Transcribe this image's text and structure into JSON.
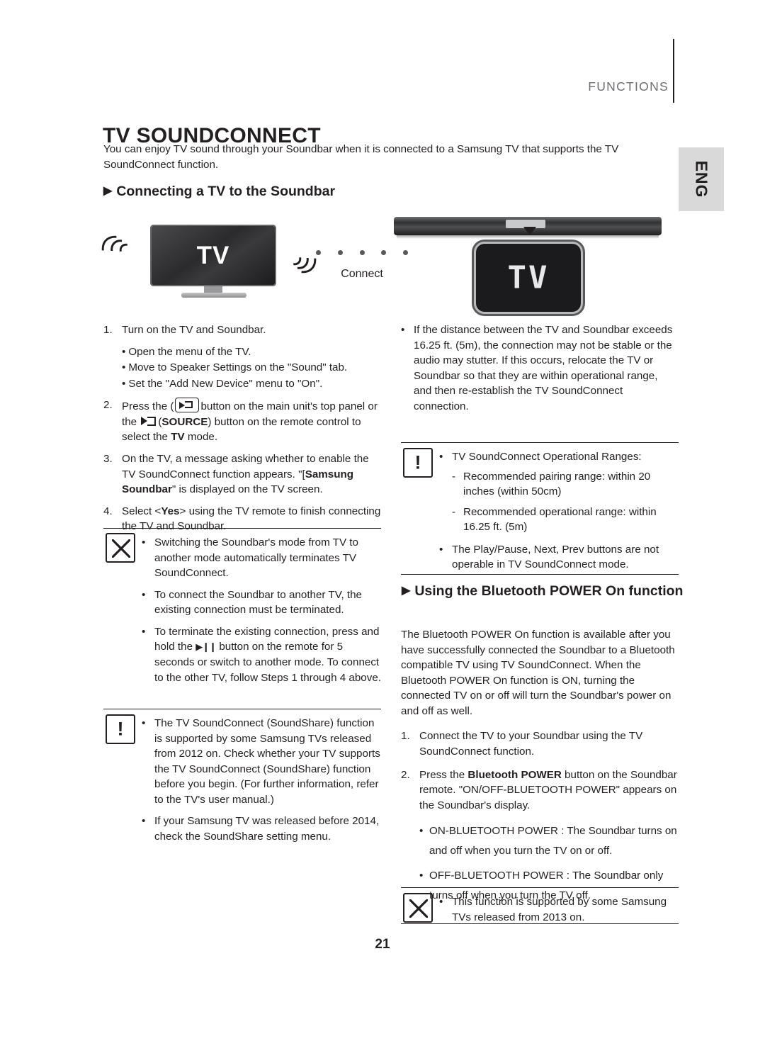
{
  "header": {
    "section_label": "FUNCTIONS",
    "lang_tab": "ENG"
  },
  "page": {
    "title": "TV SOUNDCONNECT",
    "intro": "You can enjoy TV sound through your Soundbar when it is connected to a Samsung TV that supports the TV SoundConnect function.",
    "number": "21"
  },
  "sections": {
    "connecting": {
      "heading": "Connecting a TV to the Soundbar",
      "illustration": {
        "tv_label": "TV",
        "connect_label": "Connect",
        "soundbar_display": "TV"
      },
      "steps": [
        {
          "num": "1.",
          "text": "Turn on the TV and Soundbar.",
          "subs": [
            "Open the menu of the TV.",
            "Move to Speaker Settings on the \"Sound\" tab.",
            "Set the \"Add New Device\" menu to \"On\"."
          ]
        },
        {
          "num": "2.",
          "text_pre": "Press the (",
          "text_mid": "button on the main unit's top panel or the",
          "text_src_pre": "(",
          "text_src_bold": "SOURCE",
          "text_post": ") button on the remote control to select the ",
          "text_tv_bold": "TV",
          "text_end": " mode."
        },
        {
          "num": "3.",
          "text_a": "On the TV, a message asking whether to enable the TV SoundConnect function appears. \"[",
          "text_b": "Samsung Soundbar",
          "text_c": "\" is displayed on the TV screen."
        },
        {
          "num": "4.",
          "text_a": "Select <",
          "text_b": "Yes",
          "text_c": "> using the TV remote to finish connecting the TV and Soundbar."
        }
      ],
      "memo_notes": [
        "Switching the Soundbar's mode from TV to another mode automatically terminates TV SoundConnect.",
        "To connect the Soundbar to another TV, the existing connection must be terminated."
      ],
      "memo_note_terminate_a": "To terminate the existing connection, press and hold the",
      "memo_note_terminate_b": "button on the remote for 5 seconds or switch to another mode. To connect to the other TV, follow Steps 1 through 4 above.",
      "caution_notes": [
        "The TV SoundConnect (SoundShare) function is supported by some Samsung TVs released from 2012 on. Check whether your TV supports the TV SoundConnect (SoundShare) function before you begin. (For further information, refer to the TV's user manual.)",
        "If your Samsung TV was released before 2014, check the SoundShare setting menu."
      ]
    },
    "right_column": {
      "distance_note": "If the distance between the TV and Soundbar exceeds 16.25 ft. (5m), the connection may not be stable or the audio may stutter. If this occurs, relocate the TV or Soundbar so that they are within operational range, and then re-establish the TV SoundConnect connection.",
      "caution_title": "TV SoundConnect Operational Ranges:",
      "caution_ranges": [
        "Recommended pairing range: within 20 inches (within 50cm)",
        "Recommended operational range: within 16.25 ft. (5m)"
      ],
      "caution_playpause": "The Play/Pause, Next, Prev buttons are not operable in TV SoundConnect mode."
    },
    "bluetooth": {
      "heading": "Using the Bluetooth POWER On function",
      "intro": "The Bluetooth POWER On function is available after you have successfully connected the Soundbar to a Bluetooth compatible TV using TV SoundConnect. When the Bluetooth POWER On function is ON, turning the connected TV on or off will turn the Soundbar's power on and off as well.",
      "steps": [
        {
          "num": "1.",
          "text": "Connect the TV to your Soundbar using the TV SoundConnect function."
        },
        {
          "num": "2.",
          "text_a": "Press the ",
          "text_b": "Bluetooth POWER",
          "text_c": " button on the Soundbar remote. \"ON/OFF-BLUETOOTH POWER\" appears on the Soundbar's display."
        }
      ],
      "bullets": [
        "ON-BLUETOOTH POWER : The Soundbar turns on and off when you turn the TV on or off.",
        "OFF-BLUETOOTH POWER : The Soundbar only turns off when you turn the TV off."
      ],
      "memo_note": "This function is supported by some Samsung TVs released from 2013 on."
    }
  }
}
